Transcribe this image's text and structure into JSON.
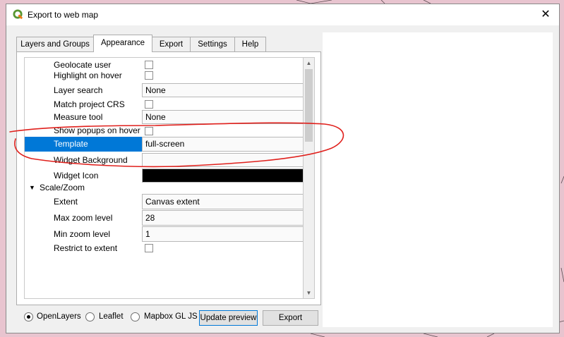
{
  "window": {
    "title": "Export to web map",
    "close_glyph": "✕"
  },
  "tabs": [
    {
      "label": "Layers and Groups",
      "active": false
    },
    {
      "label": "Appearance",
      "active": true
    },
    {
      "label": "Export",
      "active": false
    },
    {
      "label": "Settings",
      "active": false
    },
    {
      "label": "Help",
      "active": false
    }
  ],
  "appearance": {
    "geolocate_user": {
      "label": "Geolocate user",
      "checked": false
    },
    "highlight_on_hover": {
      "label": "Highlight on hover",
      "checked": false
    },
    "layer_search": {
      "label": "Layer search",
      "value": "None"
    },
    "match_project_crs": {
      "label": "Match project CRS",
      "checked": false
    },
    "measure_tool": {
      "label": "Measure tool",
      "value": "None"
    },
    "show_popups_on_hover": {
      "label": "Show popups on hover",
      "checked": false
    },
    "template": {
      "label": "Template",
      "value": "full-screen",
      "selected": true
    },
    "widget_background": {
      "label": "Widget Background",
      "value": ""
    },
    "widget_icon": {
      "label": "Widget Icon",
      "color": "#000000"
    },
    "scale_zoom": {
      "label": "Scale/Zoom",
      "expanded": true,
      "extent": {
        "label": "Extent",
        "value": "Canvas extent"
      },
      "max_zoom": {
        "label": "Max zoom level",
        "value": "28"
      },
      "min_zoom": {
        "label": "Min zoom level",
        "value": "1"
      },
      "restrict_to_extent": {
        "label": "Restrict to extent",
        "checked": false
      }
    }
  },
  "bottom": {
    "renderers": [
      {
        "label": "OpenLayers",
        "selected": true
      },
      {
        "label": "Leaflet",
        "selected": false
      },
      {
        "label": "Mapbox GL JS",
        "selected": false
      }
    ],
    "update_preview_label": "Update preview",
    "export_label": "Export"
  },
  "colors": {
    "selection": "#0078d7",
    "annotation": "#e0201c",
    "map_fill": "#e8c4cf",
    "qgis_green": "#589632"
  },
  "icons": {
    "app": "qgis-logo-icon",
    "close": "close-icon",
    "scroll_up": "scroll-up-icon",
    "scroll_down": "scroll-down-icon",
    "collapse": "collapse-arrow-icon"
  }
}
